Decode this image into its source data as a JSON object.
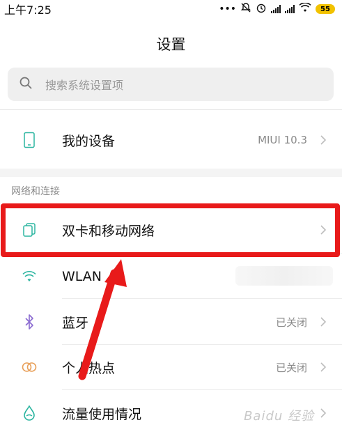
{
  "status": {
    "time": "上午7:25",
    "dots": "•••",
    "battery": "55"
  },
  "header": {
    "title": "设置"
  },
  "search": {
    "placeholder": "搜索系统设置项"
  },
  "device": {
    "label": "我的设备",
    "value": "MIUI 10.3"
  },
  "section": {
    "title": "网络和连接"
  },
  "items": [
    {
      "label": "双卡和移动网络",
      "value": "",
      "icon": "dual-sim-icon"
    },
    {
      "label": "WLAN",
      "value": "",
      "icon": "wifi-icon"
    },
    {
      "label": "蓝牙",
      "value": "已关闭",
      "icon": "bluetooth-icon"
    },
    {
      "label": "个人热点",
      "value": "已关闭",
      "icon": "hotspot-icon"
    },
    {
      "label": "流量使用情况",
      "value": "",
      "icon": "data-usage-icon"
    }
  ],
  "colors": {
    "accent": "#2bb5a0",
    "annotation": "#e81a1a"
  },
  "watermark": "Baidu 经验"
}
